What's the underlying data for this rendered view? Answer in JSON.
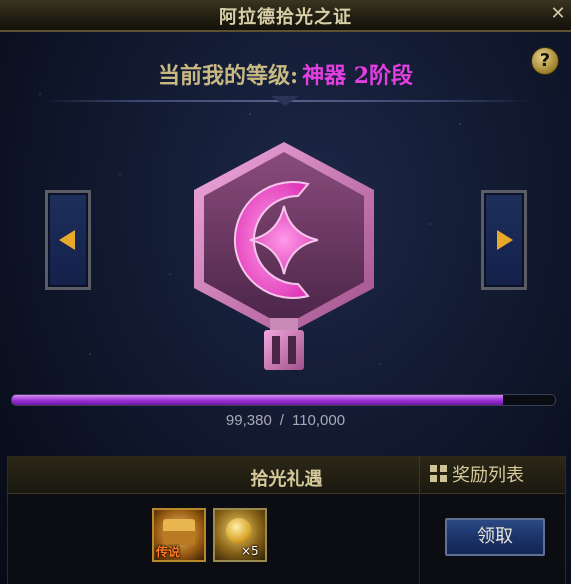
{
  "window": {
    "title": "阿拉德拾光之证",
    "close_glyph": "✕"
  },
  "help": {
    "glyph": "?"
  },
  "level": {
    "label": "当前我的等级:",
    "value": "神器  2阶段"
  },
  "nav": {
    "prev_icon": "arrow-left-icon",
    "next_icon": "arrow-right-icon"
  },
  "emblem": {
    "icon": "artifact-emblem-icon",
    "tier_numeral": "II"
  },
  "progress": {
    "current": "99,380",
    "separator": "/",
    "max": "110,000",
    "fraction": 0.9035
  },
  "rewards": {
    "title": "拾光礼遇",
    "list_label": "奖励列表",
    "items": [
      {
        "icon": "legendary-chest-icon",
        "tag": "传说"
      },
      {
        "icon": "gold-coin-icon",
        "count": "×5"
      }
    ],
    "claim_label": "领取"
  },
  "colors": {
    "accent_level": "#e23ee0",
    "progress_fill": "#9b2fd6",
    "gold": "#d6c99a"
  }
}
